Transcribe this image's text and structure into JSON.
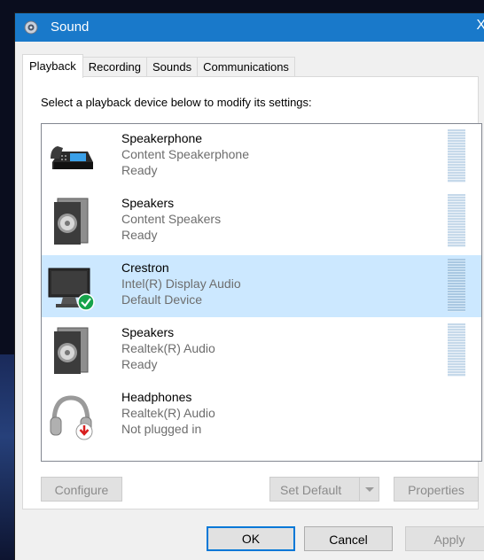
{
  "window": {
    "title": "Sound",
    "close_glyph": "X",
    "accent": "#1979ca"
  },
  "tabs": [
    {
      "label": "Playback",
      "active": true
    },
    {
      "label": "Recording",
      "active": false
    },
    {
      "label": "Sounds",
      "active": false
    },
    {
      "label": "Communications",
      "active": false
    }
  ],
  "instruction": "Select a playback device below to modify its settings:",
  "devices": [
    {
      "name": "Speakerphone",
      "description": "Content Speakerphone",
      "status": "Ready",
      "icon": "speakerphone-icon",
      "selected": false
    },
    {
      "name": "Speakers",
      "description": "Content Speakers",
      "status": "Ready",
      "icon": "speaker-icon",
      "selected": false
    },
    {
      "name": "Crestron",
      "description": "Intel(R) Display Audio",
      "status": "Default Device",
      "icon": "monitor-icon",
      "selected": true,
      "default": true
    },
    {
      "name": "Speakers",
      "description": "Realtek(R) Audio",
      "status": "Ready",
      "icon": "speaker-icon",
      "selected": false
    },
    {
      "name": "Headphones",
      "description": "Realtek(R) Audio",
      "status": "Not plugged in",
      "icon": "headphones-icon",
      "selected": false
    }
  ],
  "buttons": {
    "configure": "Configure",
    "set_default": "Set Default",
    "properties": "Properties",
    "ok": "OK",
    "cancel": "Cancel",
    "apply": "Apply"
  },
  "colors": {
    "selected_row": "#cce8ff",
    "default_check": "#16a34a",
    "unplugged_badge": "#d81e1e"
  }
}
